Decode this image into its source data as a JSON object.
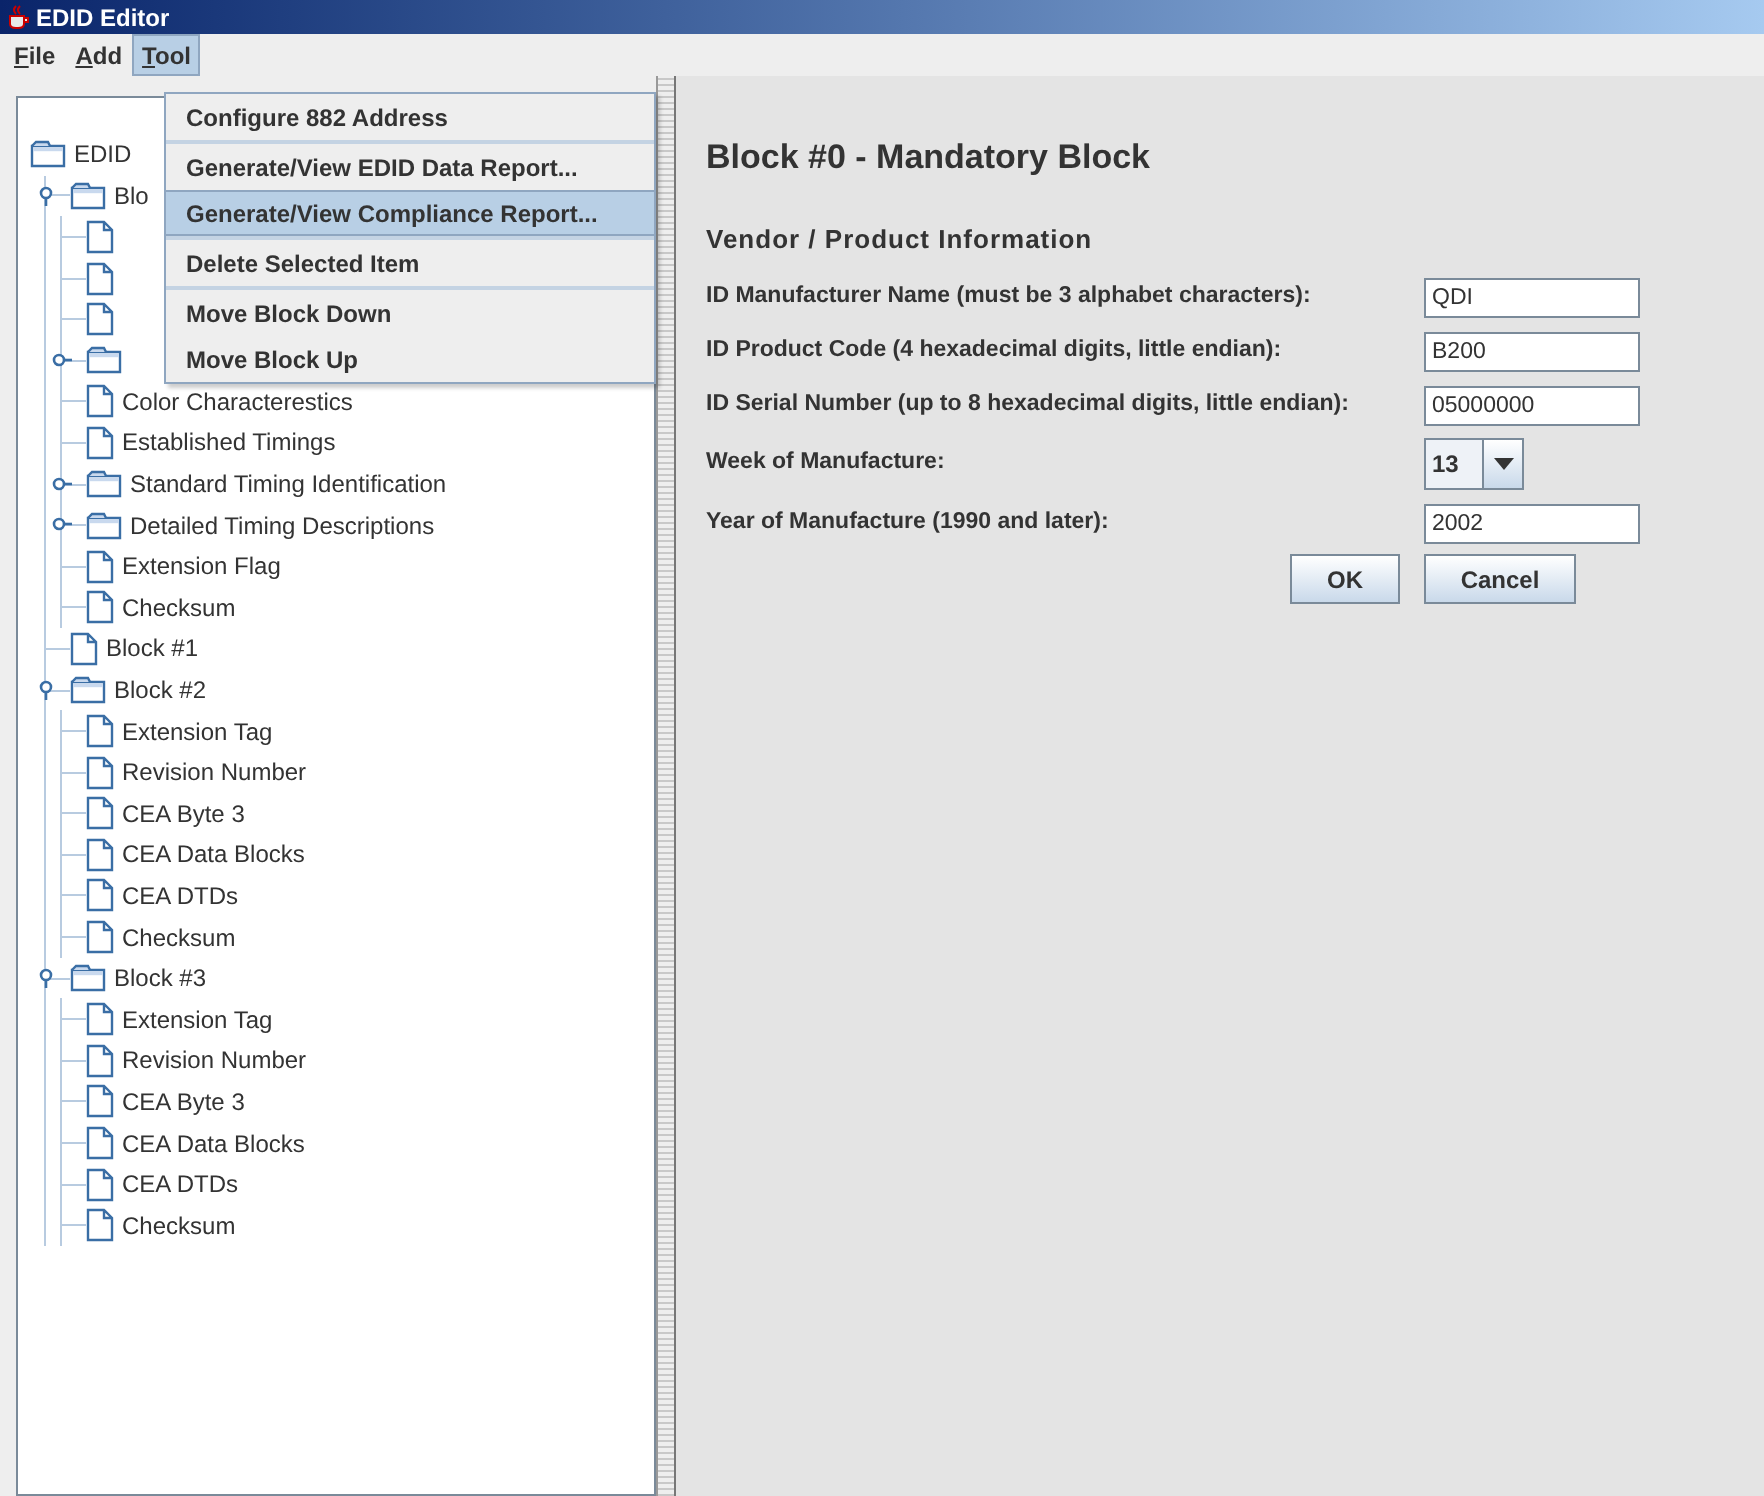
{
  "window": {
    "title": "EDID Editor"
  },
  "menu_bar": [
    {
      "label": "File",
      "selected": false
    },
    {
      "label": "Add",
      "selected": false
    },
    {
      "label": "Tool",
      "selected": true
    }
  ],
  "open_menu": {
    "groups": [
      [
        {
          "label": "Configure 882 Address",
          "selected": false
        }
      ],
      [
        {
          "label": "Generate/View EDID Data Report...",
          "selected": false
        },
        {
          "label": "Generate/View Compliance Report...",
          "selected": true
        }
      ],
      [
        {
          "label": "Delete Selected Item",
          "selected": false
        }
      ],
      [
        {
          "label": "Move Block Down",
          "selected": false
        },
        {
          "label": "Move Block Up",
          "selected": false
        }
      ]
    ]
  },
  "tree": {
    "label": "EDID",
    "kind": "folder",
    "children": [
      {
        "label": "Blo",
        "kind": "folder",
        "expanded": true,
        "children": [
          {
            "kind": "file"
          },
          {
            "kind": "file"
          },
          {
            "kind": "file"
          },
          {
            "kind": "folder",
            "expanded": false
          },
          {
            "label": "Color Characterestics",
            "kind": "file"
          },
          {
            "label": "Established Timings",
            "kind": "file"
          },
          {
            "label": "Standard Timing Identification",
            "kind": "folder",
            "expanded": false
          },
          {
            "label": "Detailed Timing Descriptions",
            "kind": "folder",
            "expanded": false
          },
          {
            "label": "Extension Flag",
            "kind": "file"
          },
          {
            "label": "Checksum",
            "kind": "file"
          }
        ]
      },
      {
        "label": "Block #1",
        "kind": "file"
      },
      {
        "label": "Block #2",
        "kind": "folder",
        "expanded": true,
        "children": [
          {
            "label": "Extension Tag",
            "kind": "file"
          },
          {
            "label": "Revision Number",
            "kind": "file"
          },
          {
            "label": "CEA Byte 3",
            "kind": "file"
          },
          {
            "label": "CEA Data Blocks",
            "kind": "file"
          },
          {
            "label": "CEA DTDs",
            "kind": "file"
          },
          {
            "label": "Checksum",
            "kind": "file"
          }
        ]
      },
      {
        "label": "Block #3",
        "kind": "folder",
        "expanded": true,
        "children": [
          {
            "label": "Extension Tag",
            "kind": "file"
          },
          {
            "label": "Revision Number",
            "kind": "file"
          },
          {
            "label": "CEA Byte 3",
            "kind": "file"
          },
          {
            "label": "CEA Data Blocks",
            "kind": "file"
          },
          {
            "label": "CEA DTDs",
            "kind": "file"
          },
          {
            "label": "Checksum",
            "kind": "file"
          }
        ]
      }
    ]
  },
  "panel": {
    "title": "Block #0 - Mandatory Block",
    "section": "Vendor / Product Information",
    "fields": [
      {
        "label": "ID Manufacturer Name (must be 3 alphabet characters):",
        "kind": "text",
        "value": "QDI"
      },
      {
        "label": "ID Product Code (4 hexadecimal digits, little endian):",
        "kind": "text",
        "value": "B200"
      },
      {
        "label": "ID Serial Number (up to 8 hexadecimal digits, little endian):",
        "kind": "text",
        "value": "05000000"
      },
      {
        "label": "Week of Manufacture:",
        "kind": "combo",
        "value": "13"
      },
      {
        "label": "Year of Manufacture (1990 and later):",
        "kind": "text",
        "value": "2002"
      }
    ],
    "buttons": [
      "OK",
      "Cancel"
    ]
  }
}
